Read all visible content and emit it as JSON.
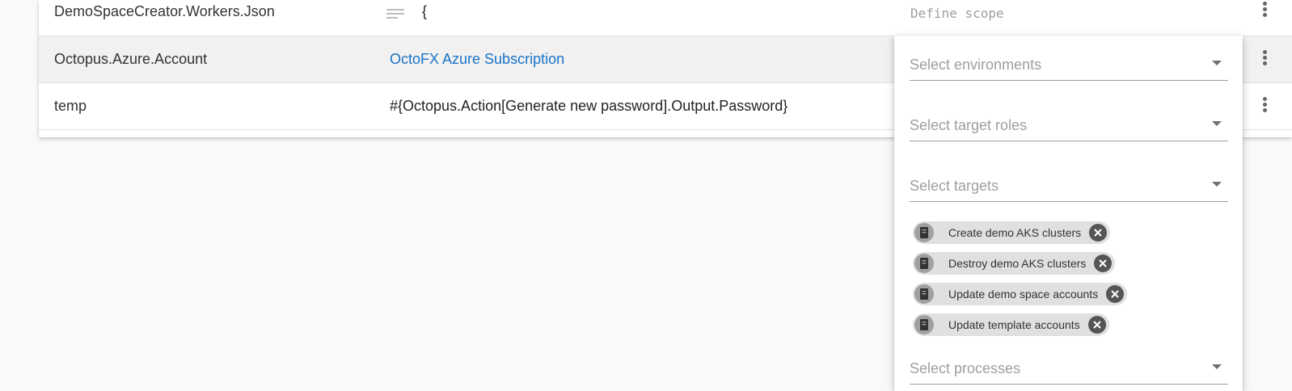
{
  "variables": {
    "rows": [
      {
        "name": "DemoSpaceCreator.Workers.Json",
        "value": "{",
        "value_type": "multiline-text",
        "scope_placeholder": "Define scope"
      },
      {
        "name": "Octopus.Azure.Account",
        "value": "OctoFX Azure Subscription",
        "value_type": "account-link"
      },
      {
        "name": "temp",
        "value": "#{Octopus.Action[Generate new password].Output.Password}",
        "value_type": "text"
      }
    ]
  },
  "scope_editor": {
    "environments_placeholder": "Select environments",
    "roles_placeholder": "Select target roles",
    "targets_placeholder": "Select targets",
    "processes_placeholder": "Select processes",
    "selected_targets": [
      {
        "label": "Create demo AKS clusters",
        "icon": "runbook-icon"
      },
      {
        "label": "Destroy demo AKS clusters",
        "icon": "runbook-icon"
      },
      {
        "label": "Update demo space accounts",
        "icon": "runbook-icon"
      },
      {
        "label": "Update template accounts",
        "icon": "runbook-icon"
      }
    ]
  },
  "colors": {
    "link": "#1a73c7",
    "placeholder": "#9e9e9e",
    "chip_bg": "#e0e0e0",
    "selected_row_bg": "#f1f1f1"
  }
}
